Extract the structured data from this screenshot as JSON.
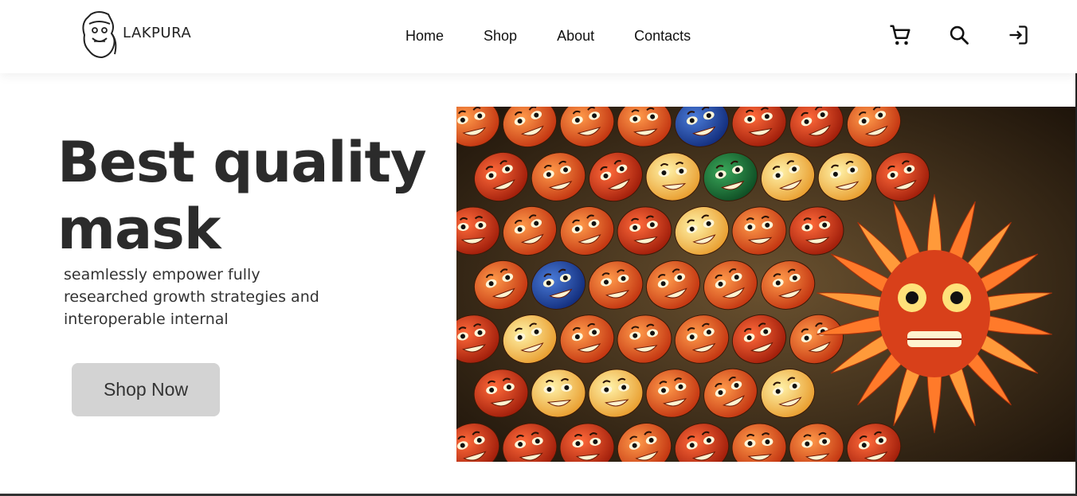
{
  "brand": {
    "name": "LAKPURA"
  },
  "nav": {
    "items": [
      {
        "label": "Home"
      },
      {
        "label": "Shop"
      },
      {
        "label": "About"
      },
      {
        "label": "Contacts"
      }
    ]
  },
  "header_icons": [
    "cart-icon",
    "search-icon",
    "login-icon"
  ],
  "hero": {
    "title_line1": "Best quality",
    "title_line2": "mask",
    "subtitle": "seamlessly empower fully researched growth strategies and interoperable internal",
    "cta_label": "Shop Now"
  },
  "colors": {
    "button_bg": "#d3d3d3",
    "title": "#2b2b2b",
    "text": "#333333"
  }
}
